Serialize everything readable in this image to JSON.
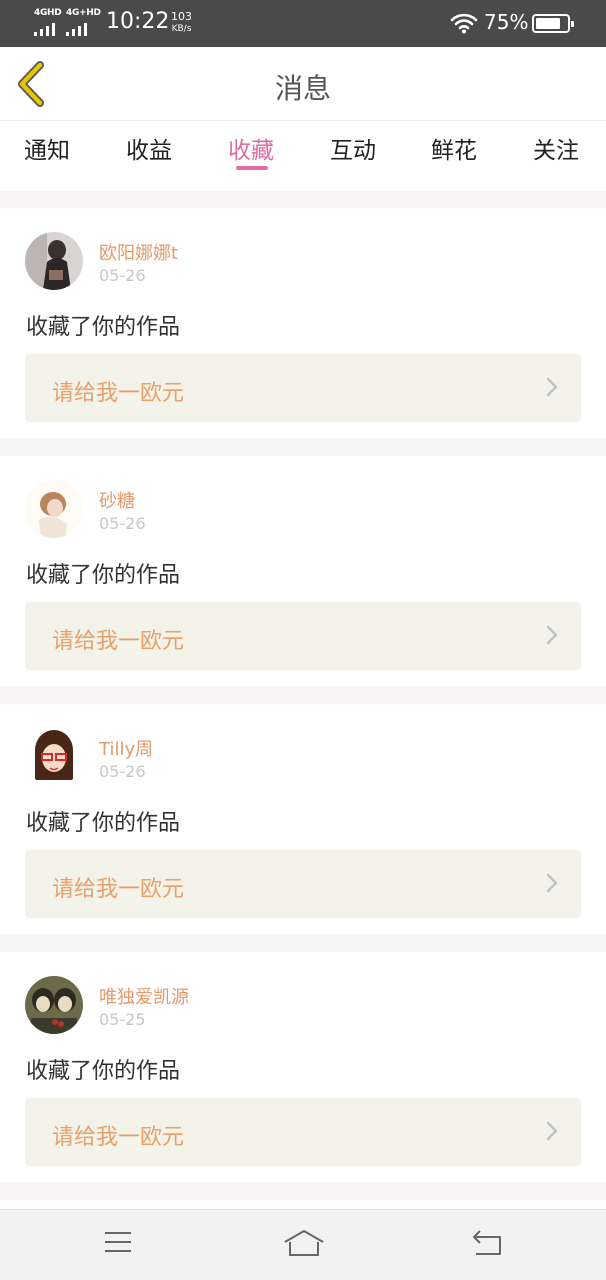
{
  "status_bar": {
    "sim1": "4GHD",
    "sim2": "4G+HD",
    "time": "10:22",
    "speed_value": "103",
    "speed_unit": "KB/s",
    "battery_text": "75%",
    "battery_level": 0.75
  },
  "header": {
    "title": "消息",
    "back_icon": "chevron-left-icon"
  },
  "tabs": [
    {
      "label": "通知",
      "active": false
    },
    {
      "label": "收益",
      "active": false
    },
    {
      "label": "收藏",
      "active": true
    },
    {
      "label": "互动",
      "active": false
    },
    {
      "label": "鲜花",
      "active": false
    },
    {
      "label": "关注",
      "active": false
    }
  ],
  "notifications": [
    {
      "user": "欧阳娜娜t",
      "date": "05-26",
      "message": "收藏了你的作品",
      "work_title": "请给我一欧元"
    },
    {
      "user": "砂糖",
      "date": "05-26",
      "message": "收藏了你的作品",
      "work_title": "请给我一欧元"
    },
    {
      "user": "Tilly周",
      "date": "05-26",
      "message": "收藏了你的作品",
      "work_title": "请给我一欧元"
    },
    {
      "user": "唯独爱凯源",
      "date": "05-25",
      "message": "收藏了你的作品",
      "work_title": "请给我一欧元"
    }
  ],
  "nav_bar": {
    "menu_icon": "menu-icon",
    "home_icon": "home-icon",
    "back_icon": "back-arrow-icon"
  },
  "colors": {
    "accent": "#e46aa0",
    "username": "#e49a6b",
    "work_title": "#e8a06a",
    "work_bg": "#f3f3ea",
    "back_chevron": "#e6c400"
  }
}
